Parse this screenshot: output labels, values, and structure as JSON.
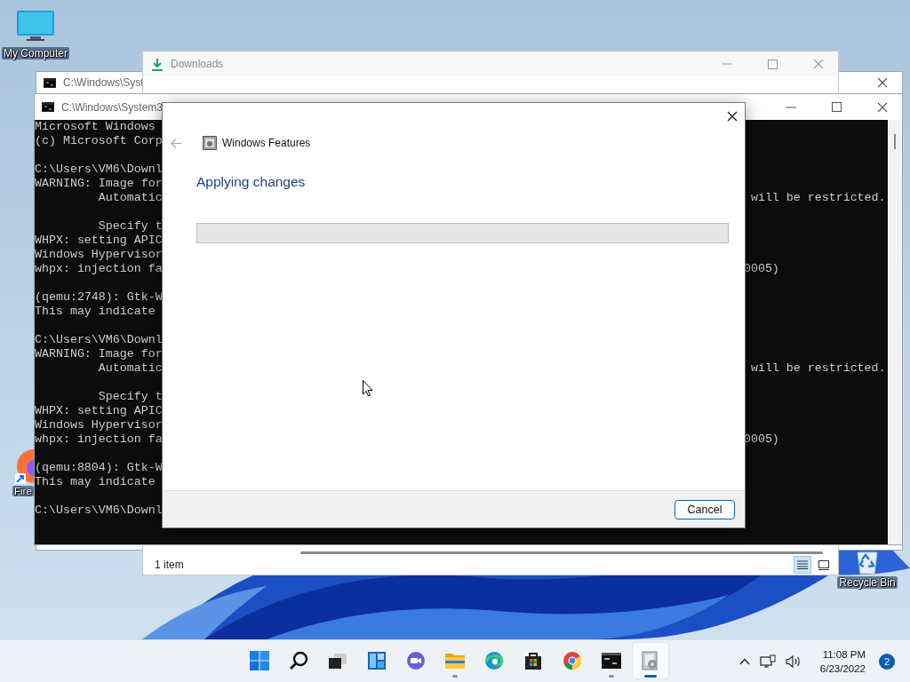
{
  "desktop_icons": [
    {
      "kind": "computer",
      "label": "My Computer"
    },
    {
      "kind": "browser",
      "label": "Fire"
    },
    {
      "kind": "recycle",
      "label": "Recycle Bin"
    }
  ],
  "back_console": {
    "title": "C:\\Windows\\Syst"
  },
  "downloads_window": {
    "title": "Downloads",
    "status": "1 item",
    "views": [
      {
        "kind": "details",
        "selected": true
      },
      {
        "kind": "tiles",
        "selected": false
      }
    ]
  },
  "front_console": {
    "title": "C:\\Windows\\System3",
    "lines": [
      {
        "kind": "text",
        "left": "Microsoft Windows"
      },
      {
        "kind": "text",
        "left": "(c) Microsoft Corp"
      },
      {
        "kind": "blank"
      },
      {
        "kind": "text",
        "left": "C:\\Users\\VM6\\Downl"
      },
      {
        "kind": "text",
        "left": "WARNING: Image for"
      },
      {
        "kind": "text",
        "left": "         Automatic",
        "right": " will be restricted."
      },
      {
        "kind": "blank"
      },
      {
        "kind": "text",
        "left": "         Specify t"
      },
      {
        "kind": "text",
        "left": "WHPX: setting APIC"
      },
      {
        "kind": "text",
        "left": "Windows Hypervisor"
      },
      {
        "kind": "text",
        "left": "whpx: injection fa",
        "right": "0005)"
      },
      {
        "kind": "blank"
      },
      {
        "kind": "text",
        "left": "(qemu:2748): Gtk-W"
      },
      {
        "kind": "text",
        "left": "This may indicate"
      },
      {
        "kind": "blank"
      },
      {
        "kind": "text",
        "left": "C:\\Users\\VM6\\Downl"
      },
      {
        "kind": "text",
        "left": "WARNING: Image for"
      },
      {
        "kind": "text",
        "left": "         Automatic",
        "right": " will be restricted."
      },
      {
        "kind": "blank"
      },
      {
        "kind": "text",
        "left": "         Specify t"
      },
      {
        "kind": "text",
        "left": "WHPX: setting APIC"
      },
      {
        "kind": "text",
        "left": "Windows Hypervisor"
      },
      {
        "kind": "text",
        "left": "whpx: injection fa",
        "right": "0005)"
      },
      {
        "kind": "blank"
      },
      {
        "kind": "text",
        "left": "(qemu:8804): Gtk-W"
      },
      {
        "kind": "text",
        "left": "This may indicate"
      },
      {
        "kind": "blank"
      },
      {
        "kind": "text",
        "left": "C:\\Users\\VM6\\Downl"
      }
    ]
  },
  "features_dialog": {
    "title": "Windows Features",
    "heading": "Applying changes",
    "progress": {
      "level": 0
    },
    "buttons": [
      "Cancel"
    ]
  },
  "taskbar": {
    "apps": [
      {
        "kind": "start",
        "running": false,
        "selected": false
      },
      {
        "kind": "search",
        "running": false,
        "selected": false
      },
      {
        "kind": "taskview",
        "running": false,
        "selected": false
      },
      {
        "kind": "widgets",
        "running": false,
        "selected": false
      },
      {
        "kind": "chat",
        "running": false,
        "selected": false
      },
      {
        "kind": "explorer",
        "running": true,
        "selected": false
      },
      {
        "kind": "edge",
        "running": false,
        "selected": false
      },
      {
        "kind": "store",
        "running": false,
        "selected": false
      },
      {
        "kind": "chrome",
        "running": false,
        "selected": false
      },
      {
        "kind": "terminal",
        "running": true,
        "selected": false
      },
      {
        "kind": "features",
        "running": true,
        "selected": true
      }
    ],
    "clock_time": "11:08 PM",
    "clock_date": "6/23/2022",
    "notifications": "2"
  }
}
